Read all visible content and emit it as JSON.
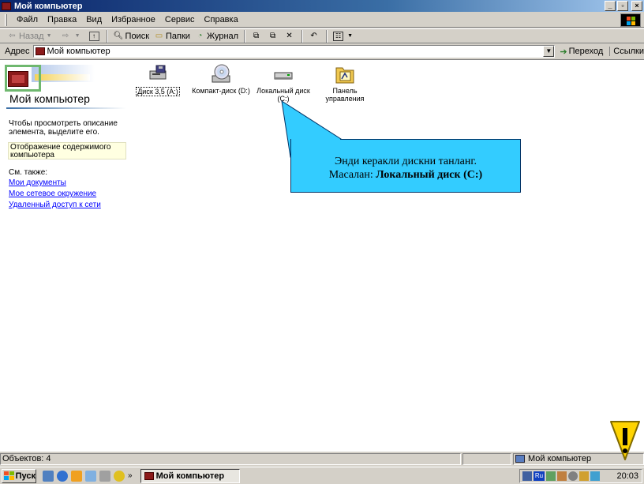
{
  "window": {
    "title": "Мой компьютер",
    "buttons": {
      "minimize": "_",
      "maximize": "▫",
      "close": "×"
    }
  },
  "menu": [
    "Файл",
    "Правка",
    "Вид",
    "Избранное",
    "Сервис",
    "Справка"
  ],
  "toolbar": {
    "back": "Назад",
    "search": "Поиск",
    "folders": "Папки",
    "history": "Журнал"
  },
  "address": {
    "label": "Адрес",
    "value": "Мой компьютер",
    "go": "Переход",
    "links": "Ссылки"
  },
  "left_pane": {
    "title": "Мой компьютер",
    "description": "Чтобы просмотреть описание элемента, выделите его.",
    "box": "Отображение содержимого компьютера",
    "see_also": "См. также:",
    "links": [
      "Мои документы",
      "Мое сетевое окружение",
      "Удаленный доступ к сети"
    ]
  },
  "drives": [
    {
      "label": "Диск 3,5 (A:)",
      "icon": "floppy-drive-icon"
    },
    {
      "label": "Компакт-диск (D:)",
      "icon": "cd-drive-icon"
    },
    {
      "label": "Локальный диск (C:)",
      "icon": "hard-drive-icon"
    },
    {
      "label": "Панель управления",
      "icon": "control-panel-icon"
    }
  ],
  "callout": {
    "line1": "Энди керакли дискни танланг.",
    "line2_prefix": "Масалан: ",
    "line2_bold": "Локальный диск (С:)"
  },
  "status": {
    "objects": "Объектов: 4",
    "location": "Мой компьютер"
  },
  "taskbar": {
    "start": "Пуск",
    "task": "Мой компьютер",
    "clock": "20:03",
    "lang": "Ru"
  },
  "colors": {
    "callout": "#33ccff",
    "titlebar": "#0a246a",
    "link": "#0000ff"
  }
}
